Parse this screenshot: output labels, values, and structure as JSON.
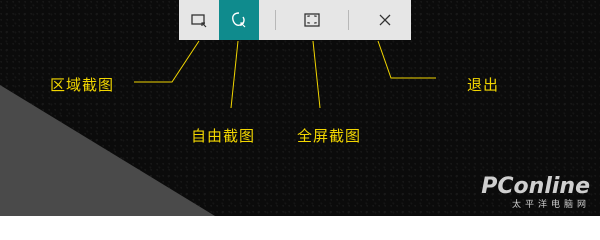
{
  "toolbar": {
    "buttons": [
      {
        "id": "rect",
        "label": "区域截图",
        "icon": "rect-snip-icon",
        "active": false
      },
      {
        "id": "freeform",
        "label": "自由截图",
        "icon": "freeform-snip-icon",
        "active": true
      },
      {
        "id": "fullscreen",
        "label": "全屏截图",
        "icon": "fullscreen-snip-icon",
        "active": false
      },
      {
        "id": "exit",
        "label": "退出",
        "icon": "close-icon",
        "active": false
      }
    ]
  },
  "labels": {
    "rect": "区域截图",
    "freeform": "自由截图",
    "fullscreen": "全屏截图",
    "exit": "退出"
  },
  "watermark": {
    "logo": "PConline",
    "sub": "太平洋电脑网"
  },
  "colors": {
    "accent": "#0f8b8d",
    "label": "#f2d600",
    "toolbar_bg": "#e6e6e6"
  }
}
